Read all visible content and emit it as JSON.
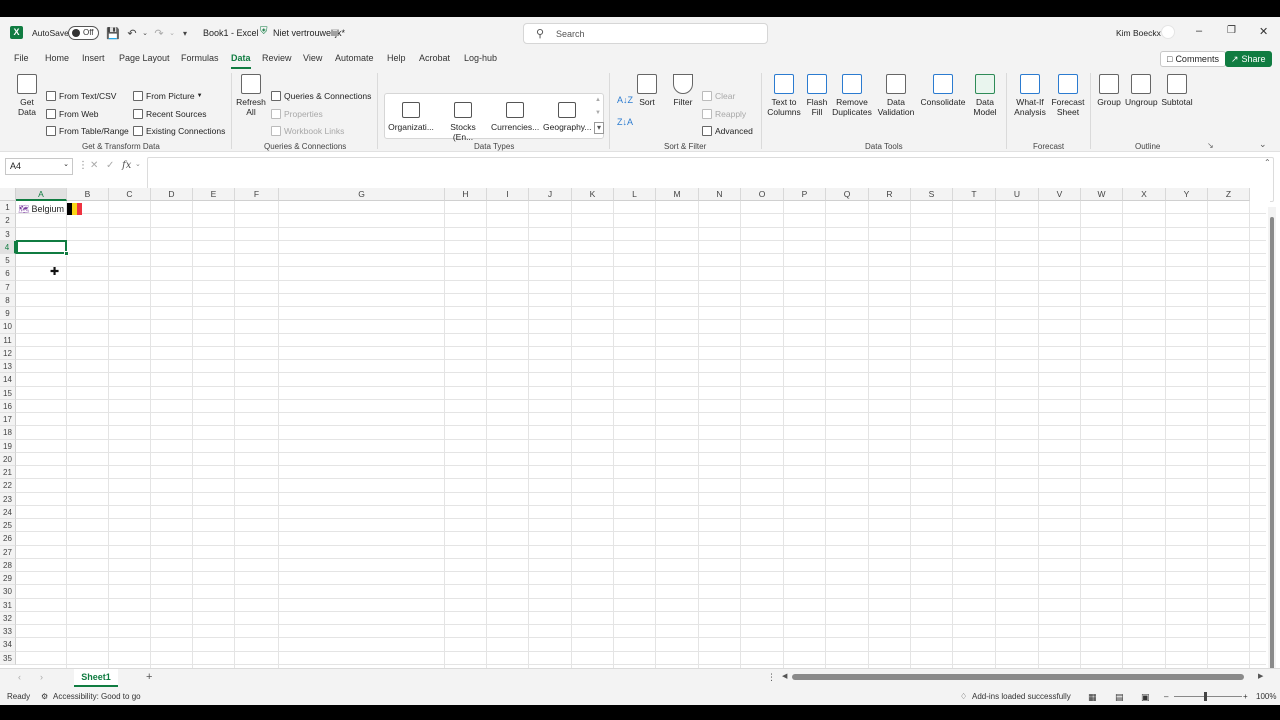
{
  "titlebar": {
    "autosave_label": "AutoSave",
    "autosave_state": "Off",
    "doc_title": "Book1  -  Excel",
    "sensitivity": "Niet vertrouwelijk*",
    "search_placeholder": "Search",
    "user": "Kim Boeckx"
  },
  "tabs": [
    "File",
    "Home",
    "Insert",
    "Page Layout",
    "Formulas",
    "Data",
    "Review",
    "View",
    "Automate",
    "Help",
    "Acrobat",
    "Log-hub"
  ],
  "active_tab": "Data",
  "comments_label": "Comments",
  "share_label": "Share",
  "ribbon": {
    "get_data": "Get Data",
    "from_text_csv": "From Text/CSV",
    "from_web": "From Web",
    "from_table_range": "From Table/Range",
    "from_picture": "From Picture",
    "recent_sources": "Recent Sources",
    "existing_connections": "Existing Connections",
    "group_get_transform": "Get & Transform Data",
    "refresh_all": "Refresh All",
    "queries_connections": "Queries & Connections",
    "properties": "Properties",
    "workbook_links": "Workbook Links",
    "group_queries": "Queries & Connections",
    "data_types": [
      "Organizati...",
      "Stocks (En...",
      "Currencies...",
      "Geography..."
    ],
    "group_data_types": "Data Types",
    "sort_label": "Sort",
    "filter_label": "Filter",
    "clear_label": "Clear",
    "reapply_label": "Reapply",
    "advanced_label": "Advanced",
    "group_sort_filter": "Sort & Filter",
    "text_to_columns": "Text to Columns",
    "flash_fill": "Flash Fill",
    "remove_duplicates": "Remove Duplicates",
    "data_validation": "Data Validation",
    "consolidate": "Consolidate",
    "data_model": "Data Model",
    "group_data_tools": "Data Tools",
    "what_if": "What-If Analysis",
    "forecast_sheet": "Forecast Sheet",
    "group_forecast": "Forecast",
    "group_btn": "Group",
    "ungroup_btn": "Ungroup",
    "subtotal_btn": "Subtotal",
    "group_outline": "Outline"
  },
  "formula_bar": {
    "name_box": "A4",
    "fx": "fx",
    "formula": ""
  },
  "grid": {
    "columns": [
      "A",
      "B",
      "C",
      "D",
      "E",
      "F",
      "G",
      "H",
      "I",
      "J",
      "K",
      "L",
      "M",
      "N",
      "O",
      "P",
      "Q",
      "R",
      "S",
      "T",
      "U",
      "V",
      "W",
      "X",
      "Y",
      "Z"
    ],
    "rows": [
      "1",
      "2",
      "3",
      "4",
      "5",
      "6",
      "7",
      "8",
      "9",
      "10",
      "11",
      "12",
      "13",
      "14",
      "15",
      "16",
      "17",
      "18",
      "19",
      "20",
      "21",
      "22",
      "23",
      "24",
      "25",
      "26",
      "27",
      "28",
      "29",
      "30",
      "31",
      "32",
      "33",
      "34",
      "35"
    ],
    "selected_cell": "A4",
    "a1_value": "Belgium",
    "flag_colors": [
      "#000000",
      "#f9d616",
      "#ef3340"
    ]
  },
  "sheets": [
    "Sheet1"
  ],
  "status": {
    "mode": "Ready",
    "accessibility": "Accessibility: Good to go",
    "addins": "Add-ins loaded successfully",
    "zoom": "100%"
  }
}
